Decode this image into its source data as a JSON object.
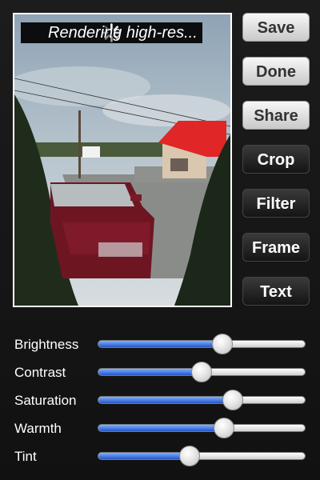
{
  "photo": {
    "status_text": "Rendering high-res..."
  },
  "buttons": [
    {
      "label": "Save",
      "style": "light"
    },
    {
      "label": "Done",
      "style": "light"
    },
    {
      "label": "Share",
      "style": "light"
    },
    {
      "label": "Crop",
      "style": "dark"
    },
    {
      "label": "Filter",
      "style": "dark"
    },
    {
      "label": "Frame",
      "style": "dark"
    },
    {
      "label": "Text",
      "style": "dark"
    }
  ],
  "adjustments": [
    {
      "label": "Brightness",
      "value": 0.6
    },
    {
      "label": "Contrast",
      "value": 0.5
    },
    {
      "label": "Saturation",
      "value": 0.65
    },
    {
      "label": "Warmth",
      "value": 0.61
    },
    {
      "label": "Tint",
      "value": 0.44
    }
  ],
  "colors": {
    "slider_fill": "#2f66d8",
    "roof_red": "#e02626"
  },
  "icons": {
    "spinner": "loading-spinner-icon"
  }
}
